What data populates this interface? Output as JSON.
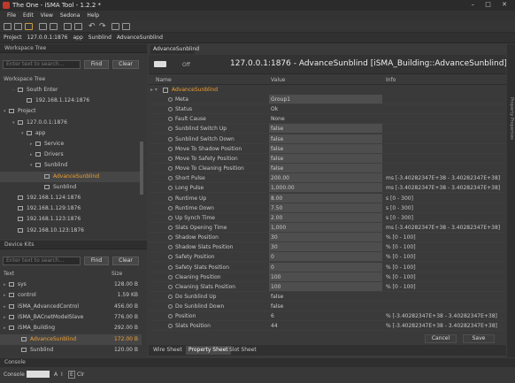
{
  "window": {
    "title": "The One - iSMA Tool - 1.2.2 *"
  },
  "menu": [
    "File",
    "Edit",
    "View",
    "Sedona",
    "Help"
  ],
  "breadcrumb": [
    "Project",
    "127.0.0.1:1876",
    "app",
    "Sunblind",
    "AdvanceSunblind"
  ],
  "workspace": {
    "title": "Workspace Tree",
    "filter_placeholder": "Enter text to search...",
    "find": "Find",
    "clear": "Clear",
    "tree_label": "Workspace Tree",
    "items": [
      {
        "label": "South Enter",
        "indent": 1,
        "expand": "-"
      },
      {
        "label": "192.168.1.124:1876",
        "indent": 2,
        "expand": ""
      },
      {
        "label": "Project",
        "indent": 0,
        "expand": "v"
      },
      {
        "label": "127.0.0.1:1876",
        "indent": 1,
        "expand": "v"
      },
      {
        "label": "app",
        "indent": 2,
        "expand": "v"
      },
      {
        "label": "Service",
        "indent": 3,
        "expand": ">"
      },
      {
        "label": "Drivers",
        "indent": 3,
        "expand": ">"
      },
      {
        "label": "Sunblind",
        "indent": 3,
        "expand": "v"
      },
      {
        "label": "AdvanceSunblind",
        "indent": 4,
        "expand": "",
        "selected": true
      },
      {
        "label": "Sunblind",
        "indent": 4,
        "expand": ""
      },
      {
        "label": "192.168.1.124:1876",
        "indent": 1,
        "expand": ""
      },
      {
        "label": "192.168.1.129:1876",
        "indent": 1,
        "expand": ""
      },
      {
        "label": "192.168.1.123:1876",
        "indent": 1,
        "expand": ""
      },
      {
        "label": "192.168.10.123:1876",
        "indent": 1,
        "expand": ""
      }
    ]
  },
  "devicekits": {
    "title": "Device Kits",
    "filter_placeholder": "Enter text to search...",
    "find": "Find",
    "clear": "Clear",
    "col_text": "Text",
    "col_size": "Size",
    "rows": [
      {
        "label": "sys",
        "size": "128.00 B",
        "indent": 0
      },
      {
        "label": "control",
        "size": "1.59 KB",
        "indent": 0
      },
      {
        "label": "iSMA_AdvancedControl",
        "size": "456.00 B",
        "indent": 0
      },
      {
        "label": "iSMA_BACnetModelSlave",
        "size": "776.00 B",
        "indent": 0
      },
      {
        "label": "iSMA_Building",
        "size": "292.00 B",
        "indent": 0
      },
      {
        "label": "AdvanceSunblind",
        "size": "172.00 B",
        "indent": 1,
        "selected": true
      },
      {
        "label": "Sunblind",
        "size": "120.00 B",
        "indent": 1
      }
    ]
  },
  "editor": {
    "tab": "AdvanceSunblind",
    "toggle": "Off",
    "heading": "127.0.0.1:1876 - AdvanceSunblind [iSMA_Building::AdvanceSunblind]",
    "col_name": "Name",
    "col_value": "Value",
    "col_info": "Info",
    "root": "AdvanceSunblind",
    "rows": [
      [
        "Meta",
        "Group1",
        "",
        1
      ],
      [
        "Status",
        "Ok",
        "",
        0
      ],
      [
        "Fault Cause",
        "None",
        "",
        0
      ],
      [
        "Sunblind Switch Up",
        "false",
        "",
        1
      ],
      [
        "Sunblind Switch Down",
        "false",
        "",
        1
      ],
      [
        "Move To Shadow Position",
        "false",
        "",
        1
      ],
      [
        "Move To Safety Position",
        "false",
        "",
        1
      ],
      [
        "Move To Cleaning Position",
        "false",
        "",
        1
      ],
      [
        "Short Pulse",
        "200.00",
        "ms [-3.40282347E+38 - 3.40282347E+38]",
        1
      ],
      [
        "Long Pulse",
        "1,000.00",
        "ms [-3.40282347E+38 - 3.40282347E+38]",
        1
      ],
      [
        "Runtime Up",
        "8.00",
        "s [0 - 300]",
        1
      ],
      [
        "Runtime Down",
        "7.50",
        "s [0 - 300]",
        1
      ],
      [
        "Up Synch Time",
        "2.00",
        "s [0 - 300]",
        1
      ],
      [
        "Slats Opening Time",
        "1,000",
        "ms [-3.40282347E+38 - 3.40282347E+38]",
        1
      ],
      [
        "Shadow Position",
        "30",
        "% [0 - 100]",
        1
      ],
      [
        "Shadow Slats Position",
        "30",
        "% [0 - 100]",
        1
      ],
      [
        "Safety Position",
        "0",
        "% [0 - 100]",
        1
      ],
      [
        "Safety Slats Position",
        "0",
        "% [0 - 100]",
        1
      ],
      [
        "Cleaning Position",
        "100",
        "% [0 - 100]",
        1
      ],
      [
        "Cleaning Slats Position",
        "100",
        "% [0 - 100]",
        1
      ],
      [
        "Do Sunblind Up",
        "false",
        "",
        0
      ],
      [
        "Do Sunblind Down",
        "false",
        "",
        0
      ],
      [
        "Position",
        "6",
        "% [-3.40282347E+38 - 3.40282347E+38]",
        0
      ],
      [
        "Slats Position",
        "44",
        "% [-3.40282347E+38 - 3.40282347E+38]",
        0
      ]
    ],
    "cancel": "Cancel",
    "save": "Save",
    "bottom_tabs": [
      "Wire Sheet",
      "Property Sheet",
      "Slot Sheet"
    ],
    "active_tab": 1
  },
  "side_tab": "Property Properties",
  "console": {
    "title": "Console",
    "label": "Console",
    "a": "A",
    "i": "I",
    "e": "E",
    "clr": "Clr"
  }
}
